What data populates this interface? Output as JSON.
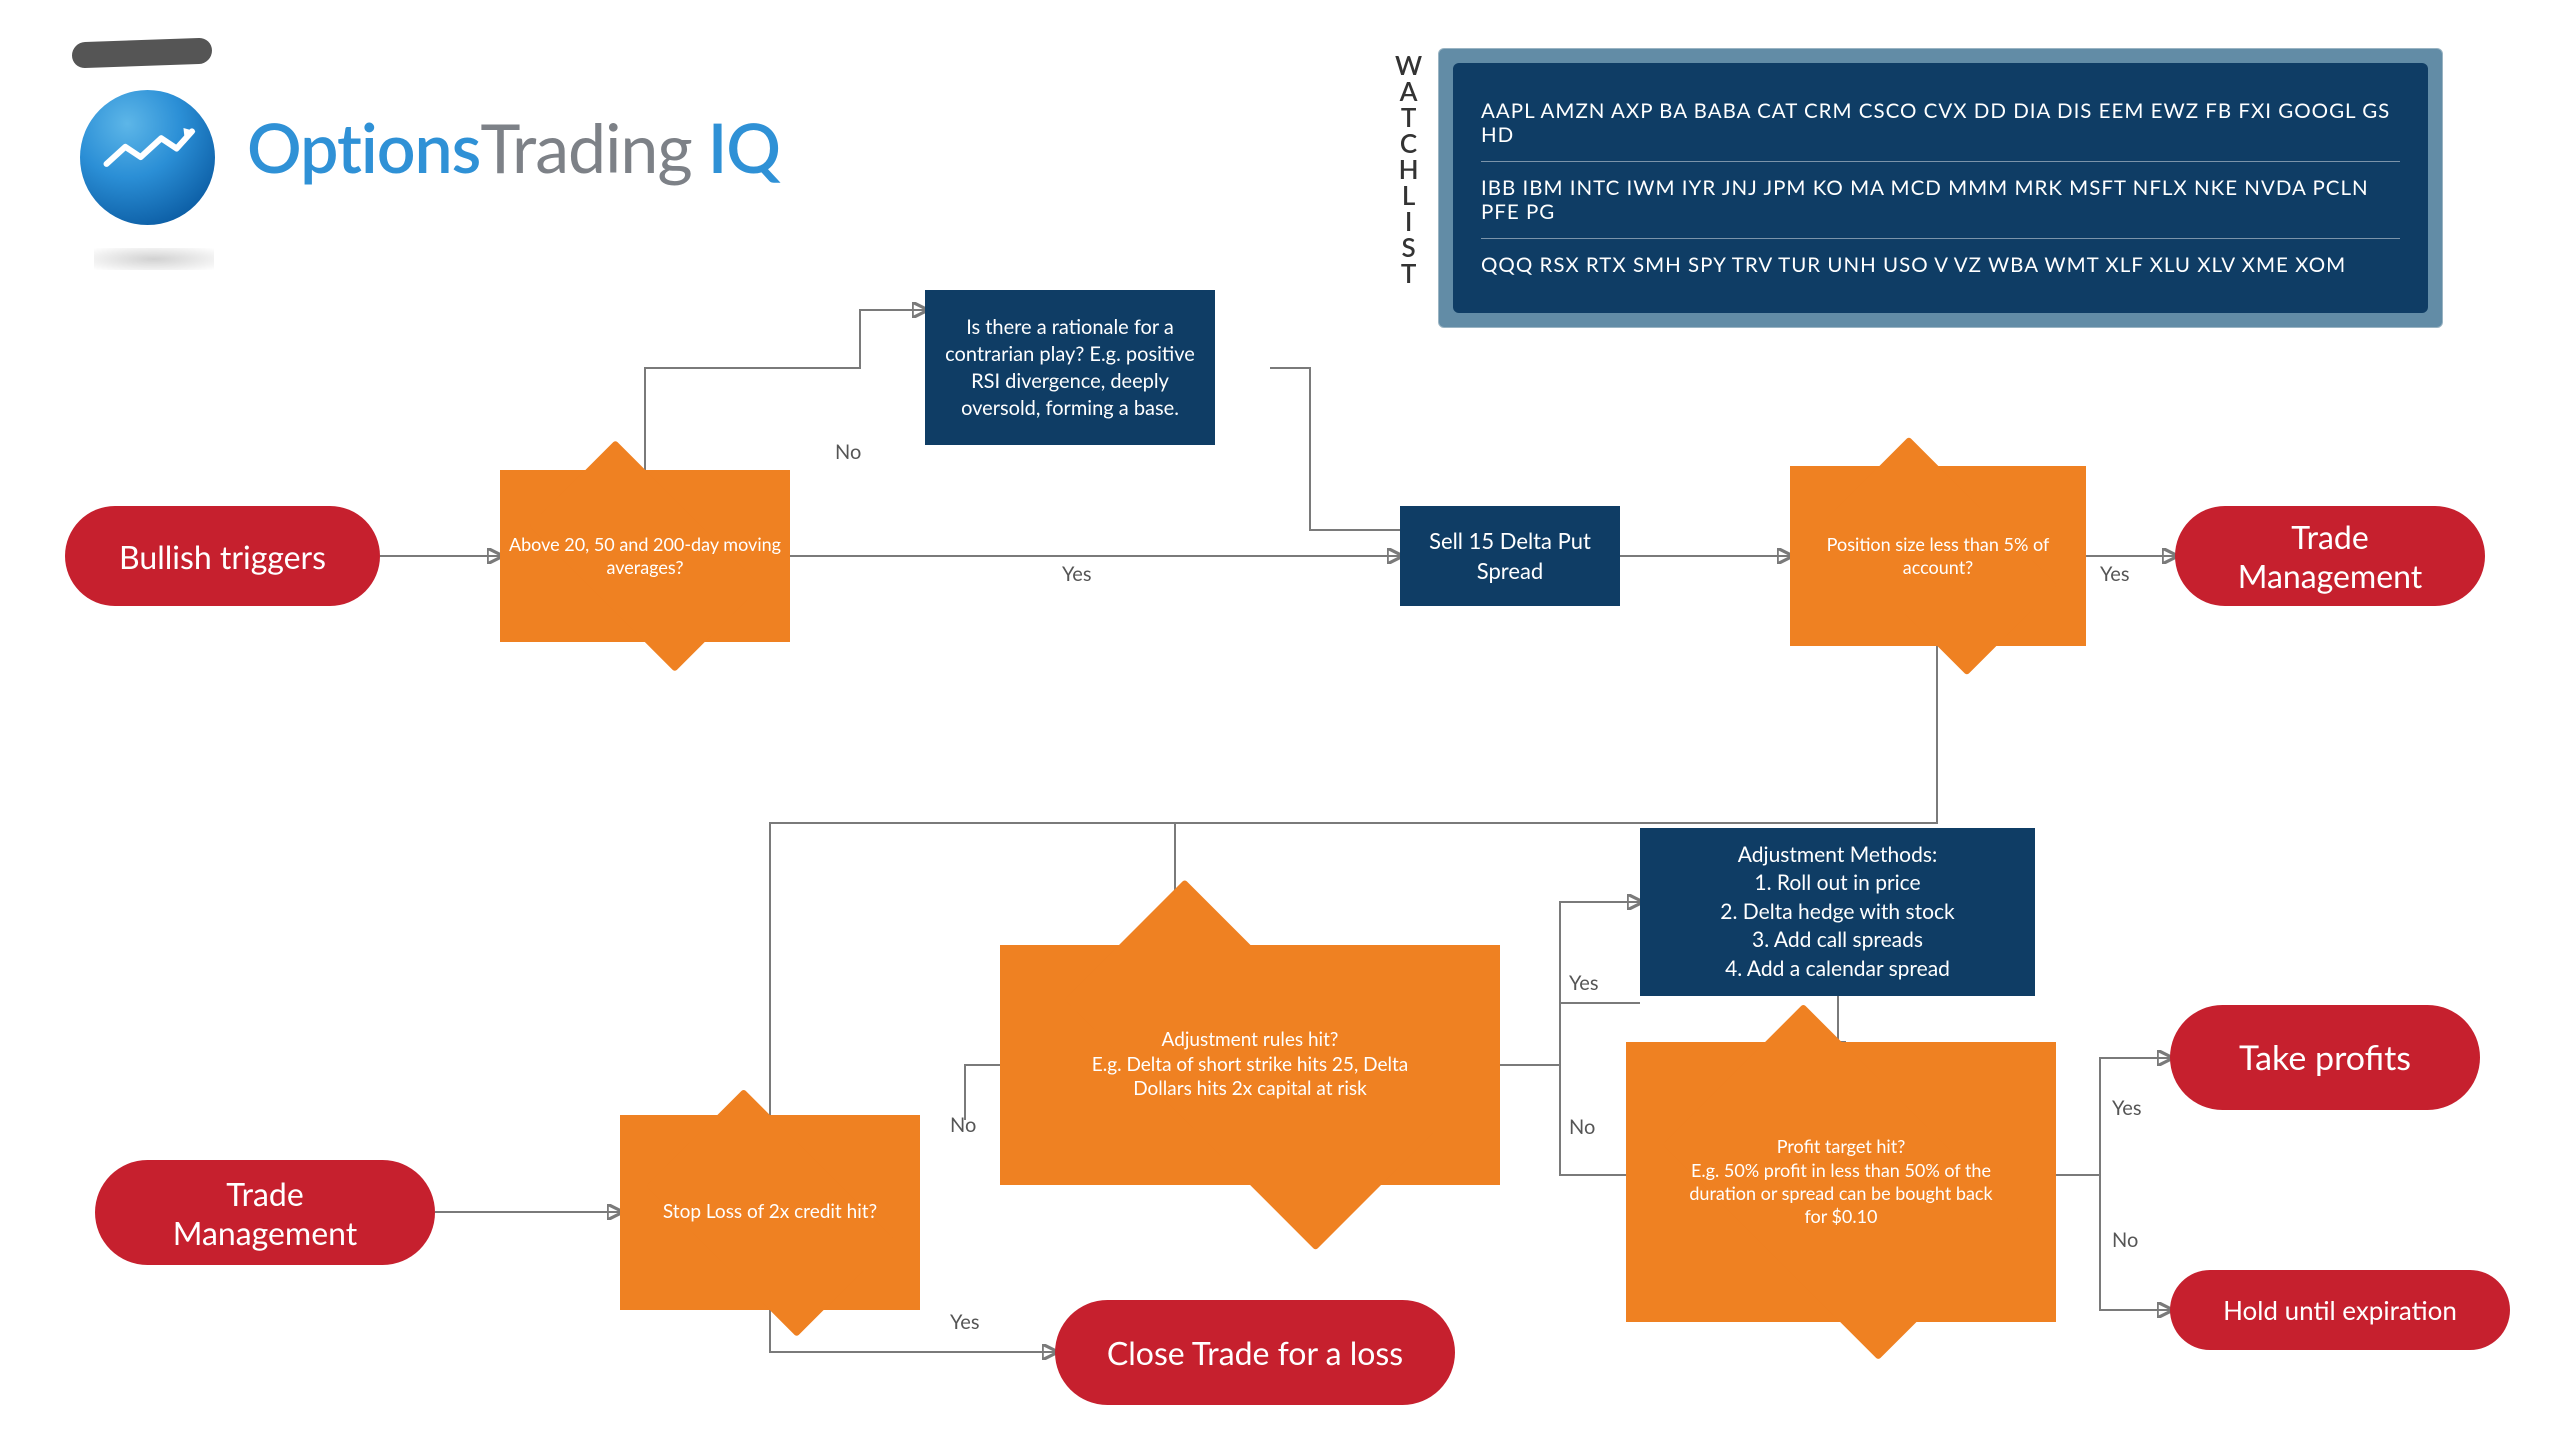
{
  "logo": {
    "word_options": "Options",
    "word_trading": "Trading",
    "word_iq": "IQ"
  },
  "watchlist": {
    "label": "WATCHLIST",
    "rows": [
      "AAPL AMZN AXP BA BABA CAT CRM CSCO CVX DD DIA DIS EEM EWZ FB FXI GOOGL GS HD",
      "IBB IBM INTC IWM IYR JNJ JPM KO MA MCD MMM MRK MSFT NFLX NKE NVDA PCLN PFE PG",
      "QQQ RSX RTX SMH SPY TRV TUR UNH USO V VZ WBA WMT XLF XLU XLV XME XOM"
    ]
  },
  "flow": {
    "bullish_triggers": "Bullish triggers",
    "dec_ma": "Above 20, 50 and 200-day moving averages?",
    "rect_contrarian": "Is there a rationale for a contrarian play? E.g. positive RSI divergence, deeply oversold, forming a base.",
    "rect_sell_spread": "Sell 15 Delta Put Spread",
    "dec_size": "Position size less than 5% of account?",
    "trade_mgmt_top": "Trade Management",
    "trade_mgmt": "Trade Management",
    "dec_stoploss": "Stop Loss of 2x credit hit?",
    "close_loss": "Close Trade for a loss",
    "dec_adjust": "Adjustment rules hit?\nE.g. Delta of short strike hits 25, Delta Dollars hits 2x capital at risk",
    "rect_adjust_methods": "Adjustment Methods:\n1. Roll out in price\n2. Delta hedge with stock\n3. Add call spreads\n4. Add a calendar spread",
    "dec_profit": "Profit target hit?\nE.g. 50% profit in less than 50% of the duration or spread can be bought back for $0.10",
    "take_profits": "Take profits",
    "hold_expiry": "Hold until expiration",
    "labels": {
      "yes": "Yes",
      "no": "No"
    }
  }
}
